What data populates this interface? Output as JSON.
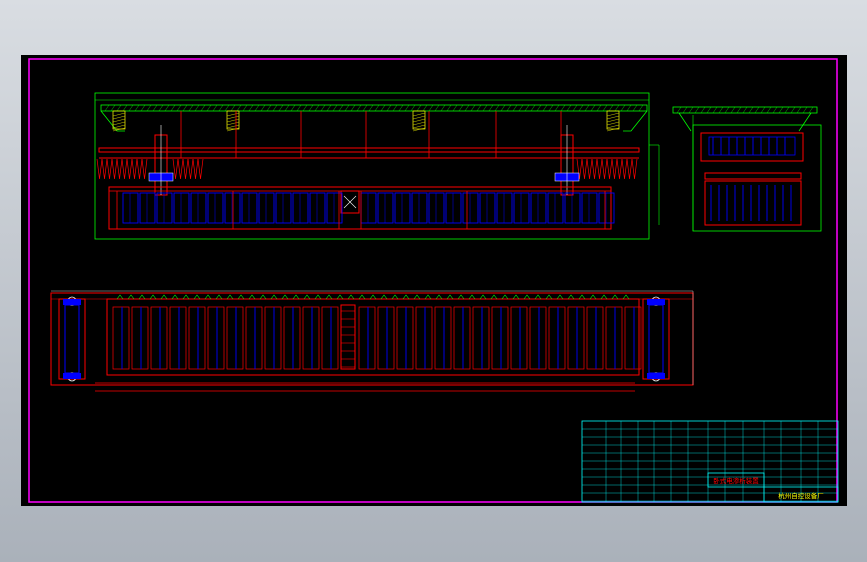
{
  "drawing": {
    "background": "#000000",
    "border_color": "#ff00ff",
    "colors": {
      "structure": "#ff0000",
      "dimension": "#00ff00",
      "panel": "#0000ff",
      "title_block": "#00ffff",
      "hatch": "#ffff00",
      "white": "#ffffff"
    }
  },
  "title_block": {
    "drawing_title": "卧式电渗析装置",
    "company": "杭州自控设备厂"
  }
}
